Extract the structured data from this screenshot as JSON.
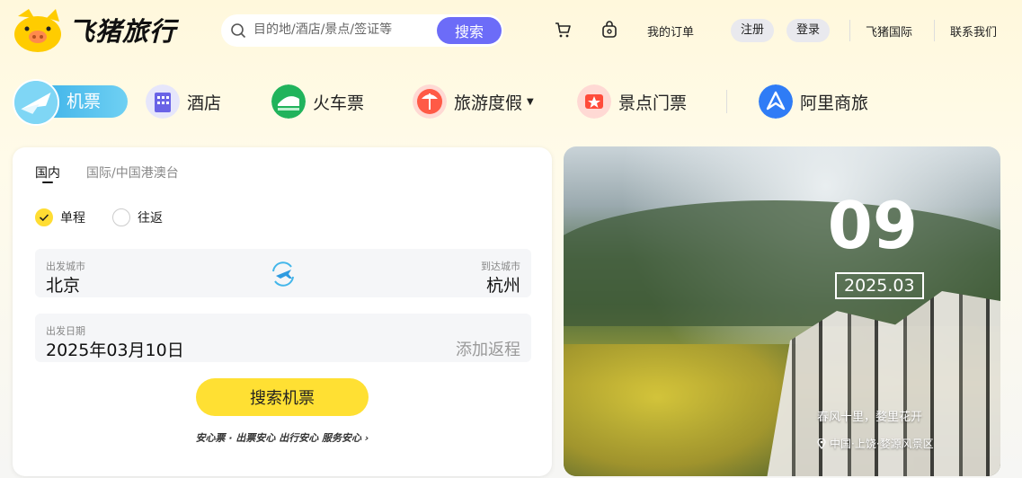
{
  "brand": {
    "name": "飞猪旅行",
    "accent": "#6c6cf8",
    "yellow": "#ffdd33"
  },
  "search": {
    "placeholder": "目的地/酒店/景点/签证等",
    "button": "搜索"
  },
  "header": {
    "icons": [
      "cart-icon",
      "bag-icon"
    ],
    "orders": "我的订单",
    "register": "注册",
    "login": "登录",
    "international": "飞猪国际",
    "contact": "联系我们"
  },
  "nav": {
    "flight": "机票",
    "hotel": "酒店",
    "train": "火车票",
    "vacation": "旅游度假",
    "tickets": "景点门票",
    "business": "阿里商旅"
  },
  "booking": {
    "tabs": [
      "国内",
      "国际/中国港澳台"
    ],
    "active_tab": 0,
    "trip_types": [
      "单程",
      "往返"
    ],
    "selected_trip": 0,
    "from_label": "出发城市",
    "from_value": "北京",
    "to_label": "到达城市",
    "to_value": "杭州",
    "date_label": "出发日期",
    "date_value": "2025年03月10日",
    "return_placeholder": "添加返程",
    "submit": "搜索机票",
    "assurance": "安心票 · 出票安心 出行安心 服务安心 ›"
  },
  "promo": {
    "day": "09",
    "month": "2025.03",
    "caption": "春风十里，婺里花开",
    "location": "中国·上饶·婺源风景区"
  }
}
